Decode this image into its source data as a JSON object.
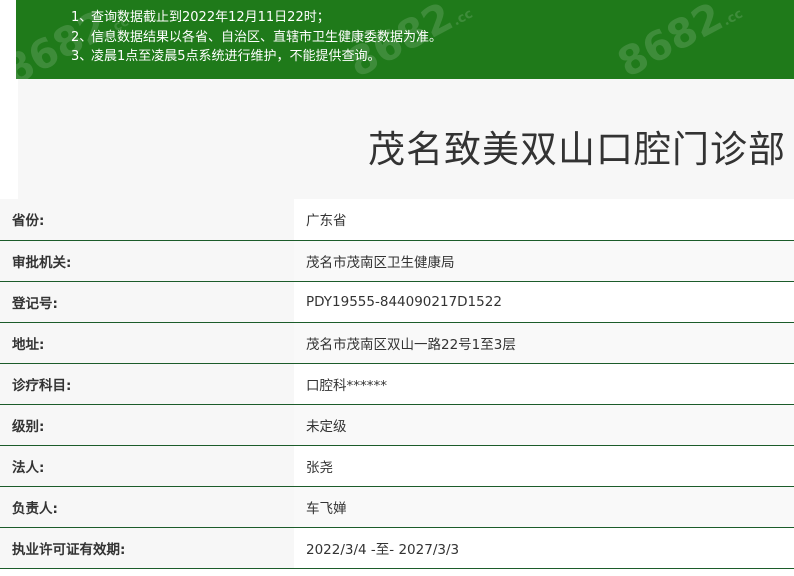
{
  "notice": {
    "lines": [
      {
        "index": "1、",
        "text": "查询数据截止到2022年12月11日22时；"
      },
      {
        "index": "2、",
        "text": "信息数据结果以各省、自治区、直辖市卫生健康委数据为准。"
      },
      {
        "index": "3、",
        "text": "凌晨1点至凌晨5点系统进行维护，不能提供查询。"
      }
    ],
    "background_color": "#1f7a1a"
  },
  "watermark": {
    "text": "8682",
    "suffix": ".cc"
  },
  "page_title": "茂名致美双山口腔门诊部",
  "details": [
    {
      "label": "省份:",
      "value": "广东省"
    },
    {
      "label": "审批机关:",
      "value": "茂名市茂南区卫生健康局"
    },
    {
      "label": "登记号:",
      "value": "PDY19555-844090217D1522"
    },
    {
      "label": "地址:",
      "value": "茂名市茂南区双山一路22号1至3层"
    },
    {
      "label": "诊疗科目:",
      "value": "口腔科******"
    },
    {
      "label": "级别:",
      "value": "未定级"
    },
    {
      "label": "法人:",
      "value": "张尧"
    },
    {
      "label": "负责人:",
      "value": "车飞婵"
    },
    {
      "label": "执业许可证有效期:",
      "value": "2022/3/4 -至- 2027/3/3"
    }
  ],
  "colors": {
    "row_divider": "#1c5c2a",
    "label_background": "#f7f7f7"
  }
}
